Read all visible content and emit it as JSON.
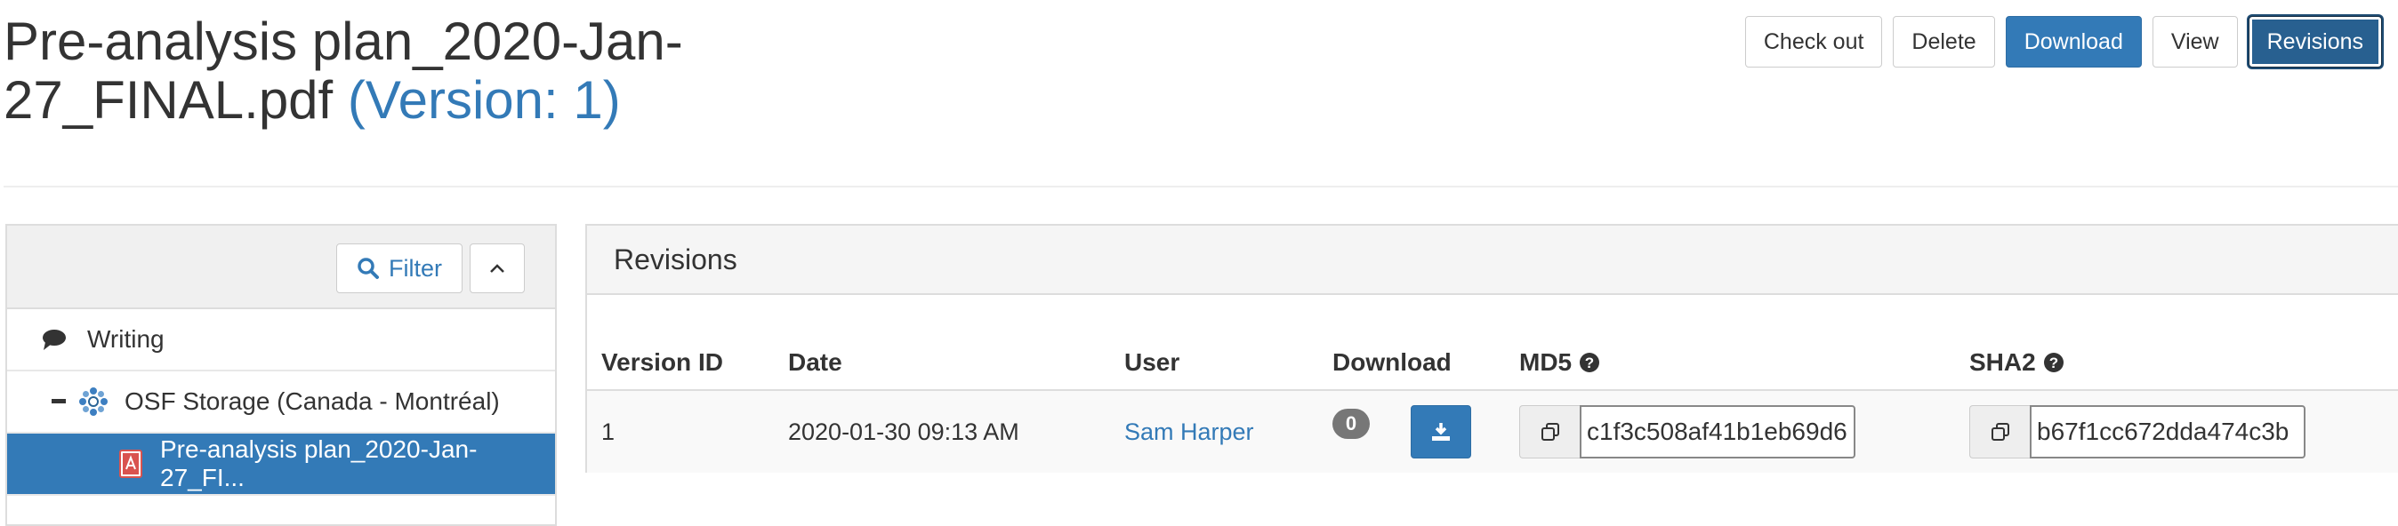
{
  "file": {
    "name": "Pre-analysis plan_2020-Jan-27_FINAL.pdf",
    "version_label": "(Version: 1)"
  },
  "actions": {
    "checkout": "Check out",
    "delete": "Delete",
    "download": "Download",
    "view": "View",
    "revisions": "Revisions"
  },
  "tree": {
    "filter_label": "Filter",
    "items": [
      {
        "label": "Writing",
        "icon": "comment-icon"
      },
      {
        "label": "OSF Storage (Canada - Montréal)",
        "icon": "storage-icon"
      },
      {
        "label": "Pre-analysis plan_2020-Jan-27_FI...",
        "icon": "pdf-icon",
        "selected": true
      }
    ]
  },
  "revisions": {
    "title": "Revisions",
    "columns": {
      "version_id": "Version ID",
      "date": "Date",
      "user": "User",
      "download": "Download",
      "md5": "MD5",
      "sha2": "SHA2"
    },
    "rows": [
      {
        "version_id": "1",
        "date": "2020-01-30 09:13 AM",
        "user": "Sam Harper",
        "downloads": "0",
        "md5": "c1f3c508af41b1eb69d6",
        "sha2": "b67f1cc672dda474c3b"
      }
    ]
  },
  "colors": {
    "primary": "#337ab7",
    "active": "#286090",
    "badge": "#777777",
    "pdf": "#d9534f"
  }
}
